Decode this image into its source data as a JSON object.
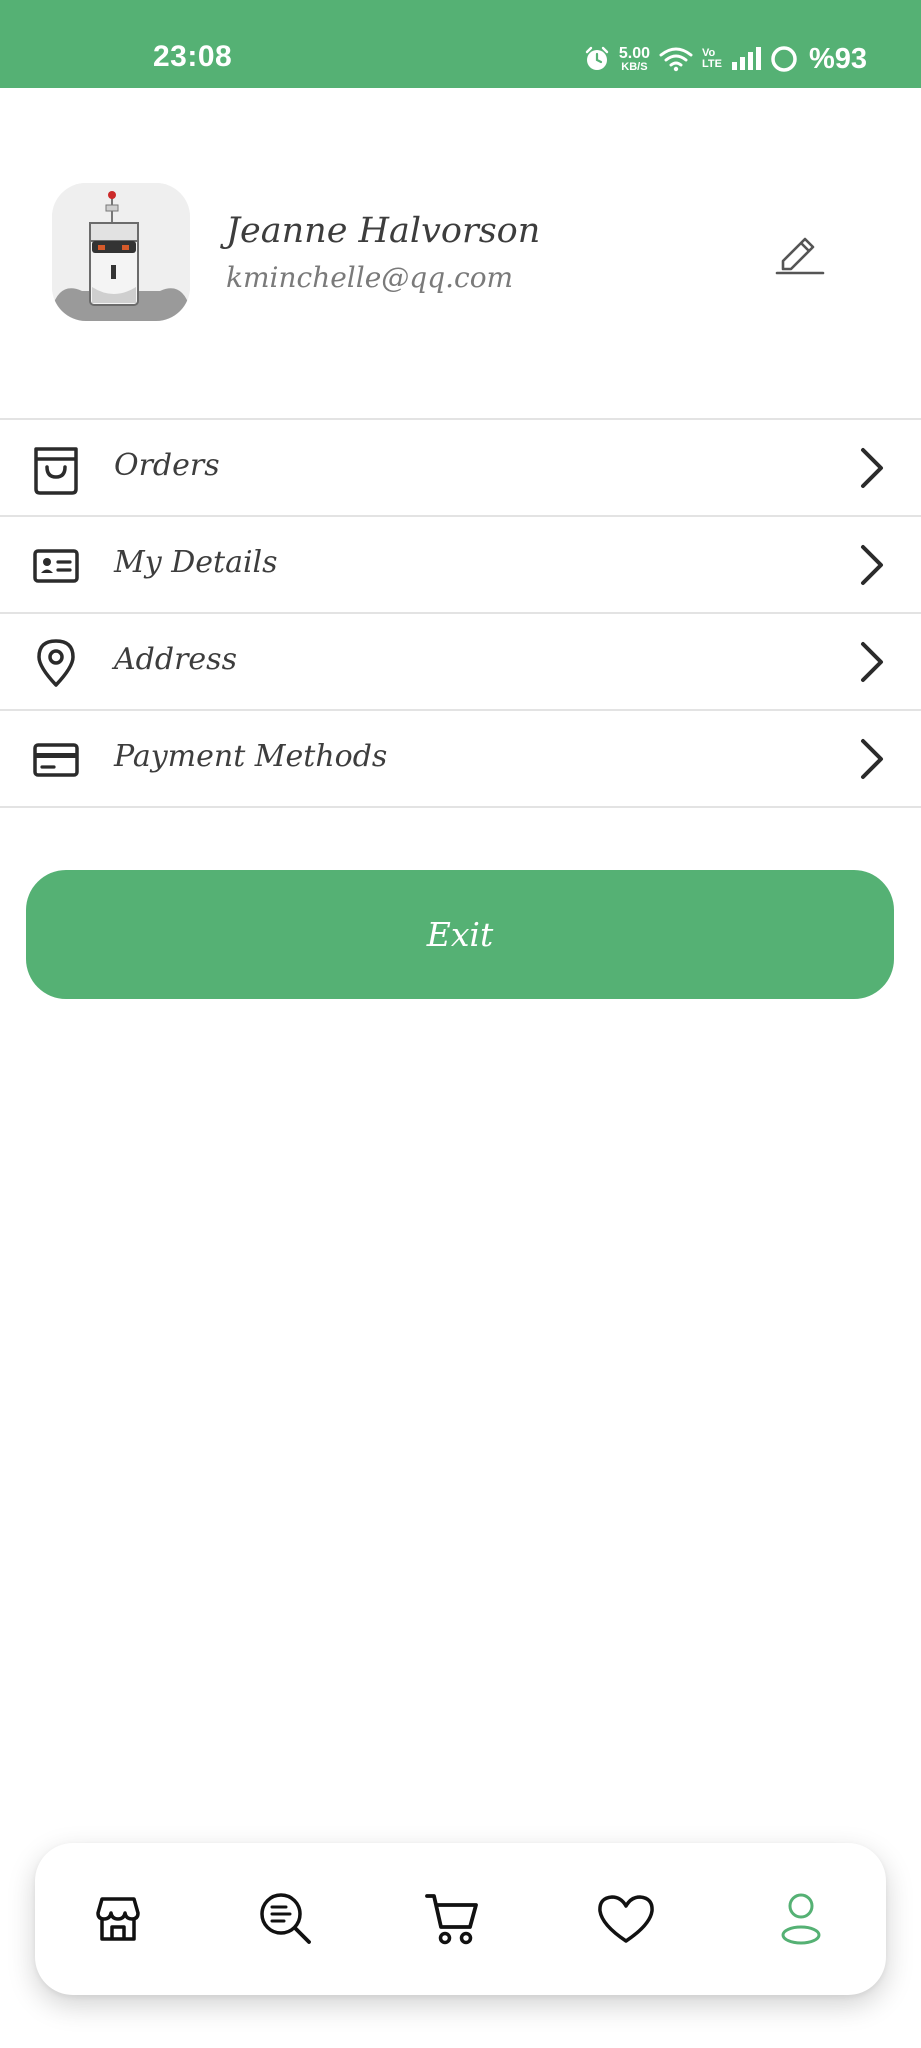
{
  "status_bar": {
    "time": "23:08",
    "net_speed_value": "5.00",
    "net_speed_unit": "KB/S",
    "volte_top": "Vo",
    "volte_bottom": "LTE",
    "battery": "%93",
    "icons": [
      "alarm-icon",
      "wifi-icon",
      "signal-icon",
      "battery-icon"
    ]
  },
  "profile": {
    "name": "Jeanne Halvorson",
    "email": "kminchelle@qq.com",
    "avatar_icon": "robot-avatar",
    "edit_icon": "pencil-icon"
  },
  "menu": {
    "items": [
      {
        "label": "Orders",
        "icon": "shopping-bag-icon"
      },
      {
        "label": "My Details",
        "icon": "id-card-icon"
      },
      {
        "label": "Address",
        "icon": "location-pin-icon"
      },
      {
        "label": "Payment Methods",
        "icon": "credit-card-icon"
      }
    ]
  },
  "exit_button": {
    "label": "Exit"
  },
  "bottom_nav": {
    "items": [
      {
        "name": "shop",
        "icon": "storefront-icon",
        "active": false
      },
      {
        "name": "explore",
        "icon": "search-list-icon",
        "active": false
      },
      {
        "name": "cart",
        "icon": "cart-icon",
        "active": false
      },
      {
        "name": "favourites",
        "icon": "heart-icon",
        "active": false
      },
      {
        "name": "account",
        "icon": "user-icon",
        "active": true
      }
    ]
  },
  "colors": {
    "accent": "#55b174",
    "text_dark": "#3d3d3d",
    "text_muted": "#7a7a7a",
    "divider": "#e3e3e3",
    "icon_dark": "#2b2b2b"
  }
}
